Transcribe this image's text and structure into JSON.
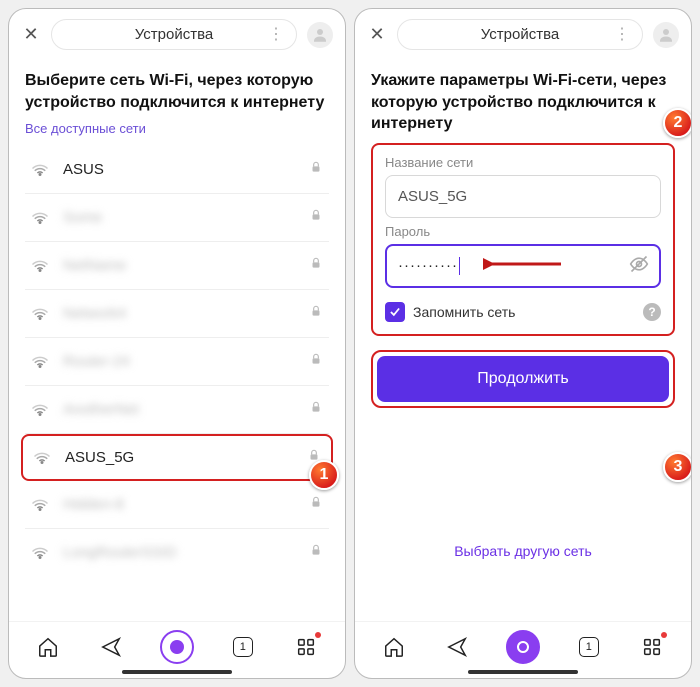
{
  "left": {
    "header_title": "Устройства",
    "heading": "Выберите сеть Wi-Fi, через которую устройство подключится к интернету",
    "subhead": "Все доступные сети",
    "networks": [
      {
        "name": "ASUS",
        "blurred": false
      },
      {
        "name": "Some",
        "blurred": true
      },
      {
        "name": "NetName",
        "blurred": true
      },
      {
        "name": "Network4",
        "blurred": true
      },
      {
        "name": "Router-24",
        "blurred": true
      },
      {
        "name": "AnotherNet",
        "blurred": true
      },
      {
        "name": "ASUS_5G",
        "blurred": false,
        "highlighted": true
      },
      {
        "name": "Hidden-8",
        "blurred": true
      },
      {
        "name": "LongRouterSSID",
        "blurred": true
      }
    ],
    "tab_count": "1",
    "badge1": "1"
  },
  "right": {
    "header_title": "Устройства",
    "heading": "Укажите параметры Wi-Fi-сети, через которую устройство подключится к интернету",
    "ssid_label": "Название сети",
    "ssid_value": "ASUS_5G",
    "password_label": "Пароль",
    "password_masked": "··········",
    "remember_label": "Запомнить сеть",
    "continue_label": "Продолжить",
    "alt_link": "Выбрать другую сеть",
    "tab_count": "1",
    "badge2": "2",
    "badge3": "3"
  }
}
